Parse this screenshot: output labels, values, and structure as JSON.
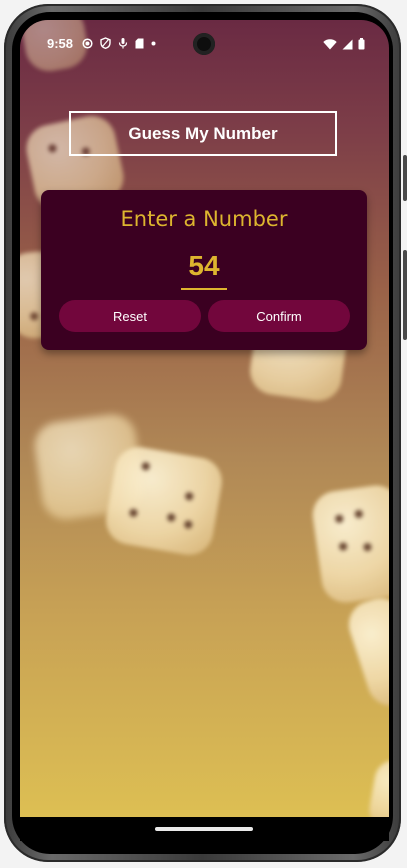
{
  "status_bar": {
    "time": "9:58",
    "left_icons": [
      "recording-icon",
      "shield-icon",
      "mic-off-icon",
      "sd-card-icon",
      "dot-icon"
    ],
    "right_icons": [
      "wifi-icon",
      "signal-icon",
      "battery-icon"
    ]
  },
  "app": {
    "title": "Guess My Number"
  },
  "card": {
    "title": "Enter a Number",
    "input_value": "54",
    "reset_label": "Reset",
    "confirm_label": "Confirm"
  },
  "colors": {
    "card_background": "#3b0021",
    "accent_yellow": "#ddb52f",
    "button_background": "#72063c",
    "gradient_top": "#6a2a43",
    "gradient_bottom": "#ddbf53"
  }
}
